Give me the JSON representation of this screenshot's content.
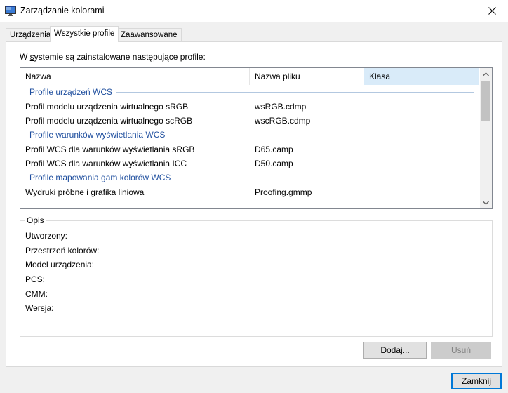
{
  "window": {
    "title": "Zarządzanie kolorami"
  },
  "tabs": [
    {
      "label": "Urządzenia"
    },
    {
      "label": "Wszystkie profile"
    },
    {
      "label": "Zaawansowane"
    }
  ],
  "profiles": {
    "caption_pre": "W ",
    "caption_key": "s",
    "caption_post": "ystemie są zainstalowane następujące profile:",
    "columns": {
      "name": "Nazwa",
      "file": "Nazwa pliku",
      "class": "Klasa"
    },
    "groups": [
      {
        "label": "Profile urządzeń WCS",
        "rows": [
          {
            "name": "Profil modelu urządzenia wirtualnego sRGB",
            "file": "wsRGB.cdmp"
          },
          {
            "name": "Profil modelu urządzenia wirtualnego scRGB",
            "file": "wscRGB.cdmp"
          }
        ]
      },
      {
        "label": "Profile warunków wyświetlania WCS",
        "rows": [
          {
            "name": "Profil WCS dla warunków wyświetlania sRGB",
            "file": "D65.camp"
          },
          {
            "name": "Profil WCS dla warunków wyświetlania ICC",
            "file": "D50.camp"
          }
        ]
      },
      {
        "label": "Profile mapowania gam kolorów WCS",
        "rows": [
          {
            "name": "Wydruki próbne i grafika liniowa",
            "file": "Proofing.gmmp"
          }
        ]
      }
    ]
  },
  "description": {
    "title": "Opis",
    "created": "Utworzony:",
    "color_space": "Przestrzeń kolorów:",
    "device_model": "Model urządzenia:",
    "pcs": "PCS:",
    "cmm": "CMM:",
    "version": "Wersja:"
  },
  "buttons": {
    "add_key": "D",
    "add_rest": "odaj...",
    "remove_pre": "U",
    "remove_key": "s",
    "remove_post": "uń",
    "close": "Zamknij"
  },
  "colors": {
    "accent": "#0078d7",
    "group_text": "#1e4e9e",
    "selected_header": "#d9ebf9"
  }
}
